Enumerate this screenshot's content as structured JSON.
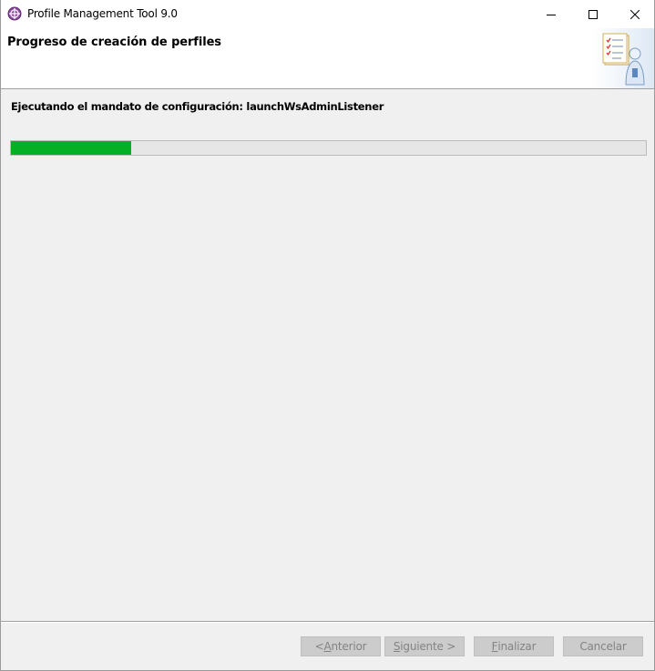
{
  "window": {
    "title": "Profile Management Tool 9.0",
    "app_icon": "globe-icon",
    "controls": {
      "minimize_icon": "minimize-icon",
      "maximize_icon": "maximize-icon",
      "close_icon": "close-icon"
    }
  },
  "banner": {
    "title": "Progreso de creación de perfiles",
    "graphic_icon": "checklist-person-icon"
  },
  "status": {
    "text": "Ejecutando el mandato de configuración: launchWsAdminListener"
  },
  "progress": {
    "fraction": 0.19,
    "fill_color": "#06b025",
    "track_color": "#e6e6e6"
  },
  "buttons": {
    "back": {
      "prefix": "< ",
      "mnemonic": "A",
      "rest": "nterior",
      "enabled": false
    },
    "next": {
      "prefix": "",
      "mnemonic": "S",
      "rest": "iguiente >",
      "enabled": false
    },
    "finish": {
      "prefix": "",
      "mnemonic": "F",
      "rest": "inalizar",
      "enabled": false
    },
    "cancel": {
      "label": "Cancelar",
      "enabled": false
    }
  },
  "colors": {
    "background": "#f0f0f0",
    "banner_background": "#ffffff",
    "disabled_button": "#cccccc",
    "disabled_text": "#838383"
  }
}
